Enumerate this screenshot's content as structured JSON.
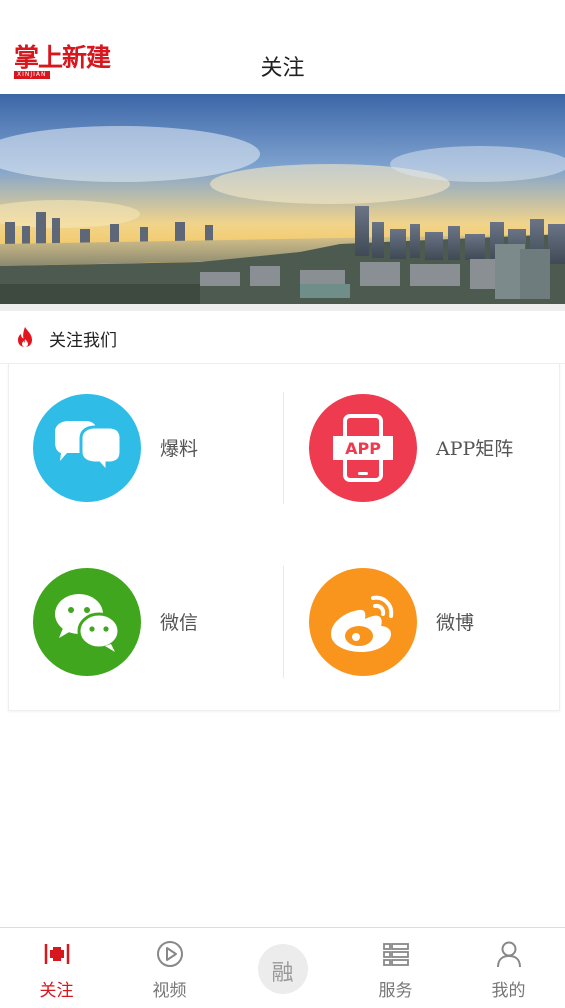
{
  "header": {
    "logo_text": "掌上新建",
    "logo_sub": "XINJIAN",
    "title": "关注"
  },
  "section": {
    "title": "关注我们"
  },
  "tiles": [
    {
      "label": "爆料",
      "color": "#2fbde8",
      "icon": "chat-bubbles-icon"
    },
    {
      "label": "APP矩阵",
      "color": "#ee3b4f",
      "icon": "app-phone-icon",
      "icon_text": "APP"
    },
    {
      "label": "微信",
      "color": "#40a61d",
      "icon": "wechat-icon"
    },
    {
      "label": "微博",
      "color": "#f9941c",
      "icon": "weibo-icon"
    }
  ],
  "tabbar": {
    "items": [
      {
        "label": "关注",
        "icon": "follow-icon",
        "active": true
      },
      {
        "label": "视频",
        "icon": "play-icon"
      },
      {
        "label": "融",
        "icon": "center-rong-icon"
      },
      {
        "label": "服务",
        "icon": "list-icon"
      },
      {
        "label": "我的",
        "icon": "user-icon"
      }
    ]
  },
  "colors": {
    "brand_red": "#d8161e"
  }
}
